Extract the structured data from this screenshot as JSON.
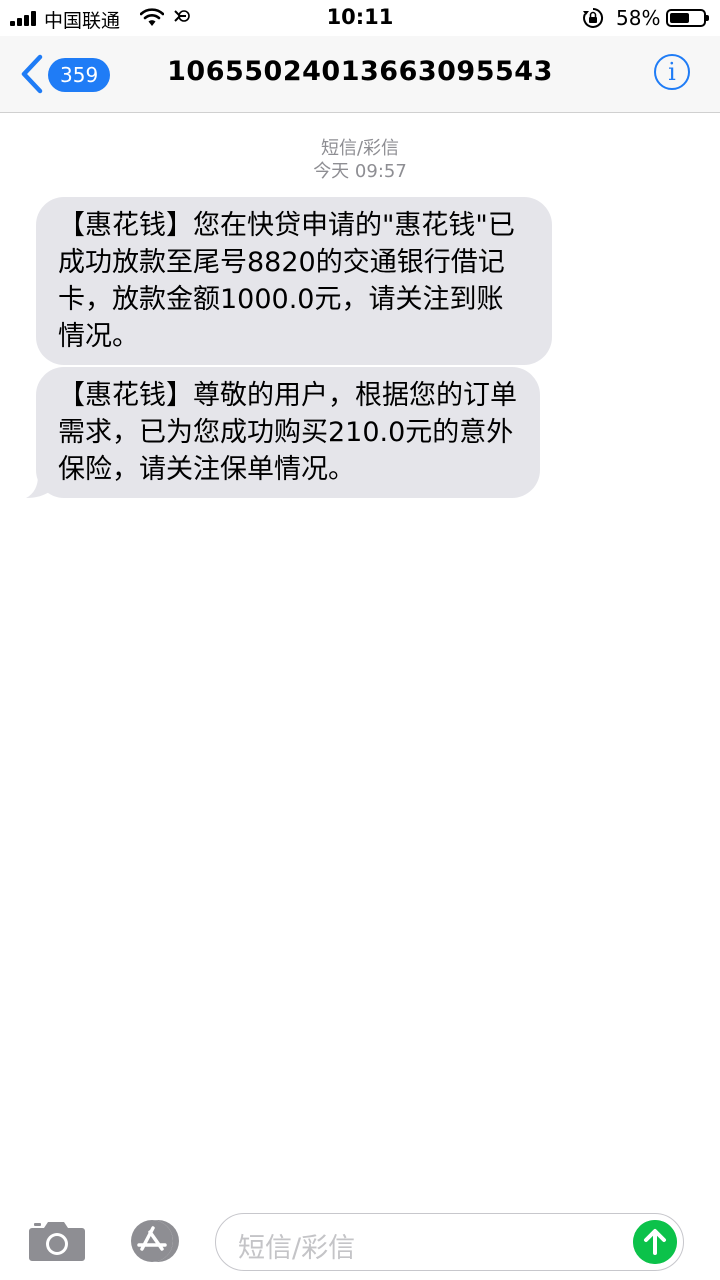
{
  "status_bar": {
    "carrier": "中国联通",
    "time": "10:11",
    "battery_percent_text": "58%",
    "battery_level": 0.58
  },
  "nav": {
    "back_badge": "359",
    "contact": "10655024013663095543",
    "info_icon": "info-icon"
  },
  "conversation": {
    "type_label": "短信/彩信",
    "timestamp": "今天 09:57",
    "messages": [
      {
        "text": "【惠花钱】您在快贷申请的\"惠花钱\"已成功放款至尾号8820的交通银行借记卡，放款金额1000.0元，请关注到账情况。"
      },
      {
        "text": "【惠花钱】尊敬的用户，根据您的订单需求，已为您成功购买210.0元的意外保险，请关注保单情况。"
      }
    ]
  },
  "input_bar": {
    "placeholder": "短信/彩信",
    "icons": [
      "camera-icon",
      "app-store-icon",
      "send-arrow-icon"
    ],
    "send_color": "#0cc24a"
  },
  "colors": {
    "accent": "#1f7cf6",
    "bubble": "#e5e5ea",
    "meta_text": "#8e8e93"
  }
}
